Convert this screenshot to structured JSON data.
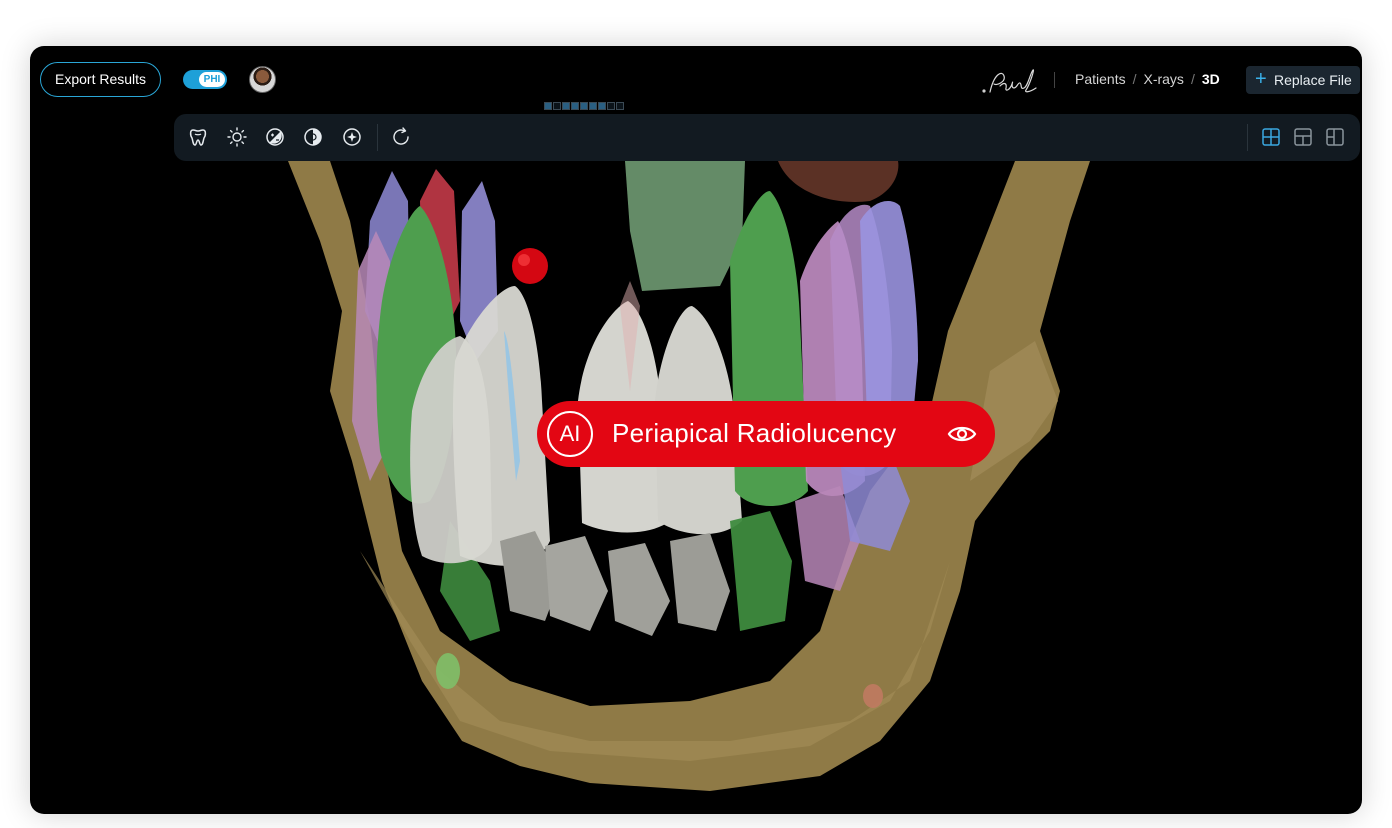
{
  "header": {
    "export_label": "Export Results",
    "phi_label": "PHI",
    "breadcrumb": {
      "patients": "Patients",
      "sep": "/",
      "xrays": "X-rays",
      "current": "3D"
    },
    "replace_label": "Replace File",
    "logo_text": "Pearl"
  },
  "toolbar": {
    "tools": [
      "tooth-icon",
      "brightness-icon",
      "contrast-icon",
      "invert-icon",
      "sharpen-icon",
      "rotate-icon"
    ],
    "layouts": [
      "grid-layout-icon",
      "split-horizontal-layout-icon",
      "split-vertical-layout-icon"
    ]
  },
  "annotation": {
    "badge": "AI",
    "label": "Periapical Radiolucency",
    "color": "#e30613"
  },
  "colors": {
    "accent": "#1ea0d8",
    "background": "#000000",
    "toolbar": "#121a21"
  }
}
